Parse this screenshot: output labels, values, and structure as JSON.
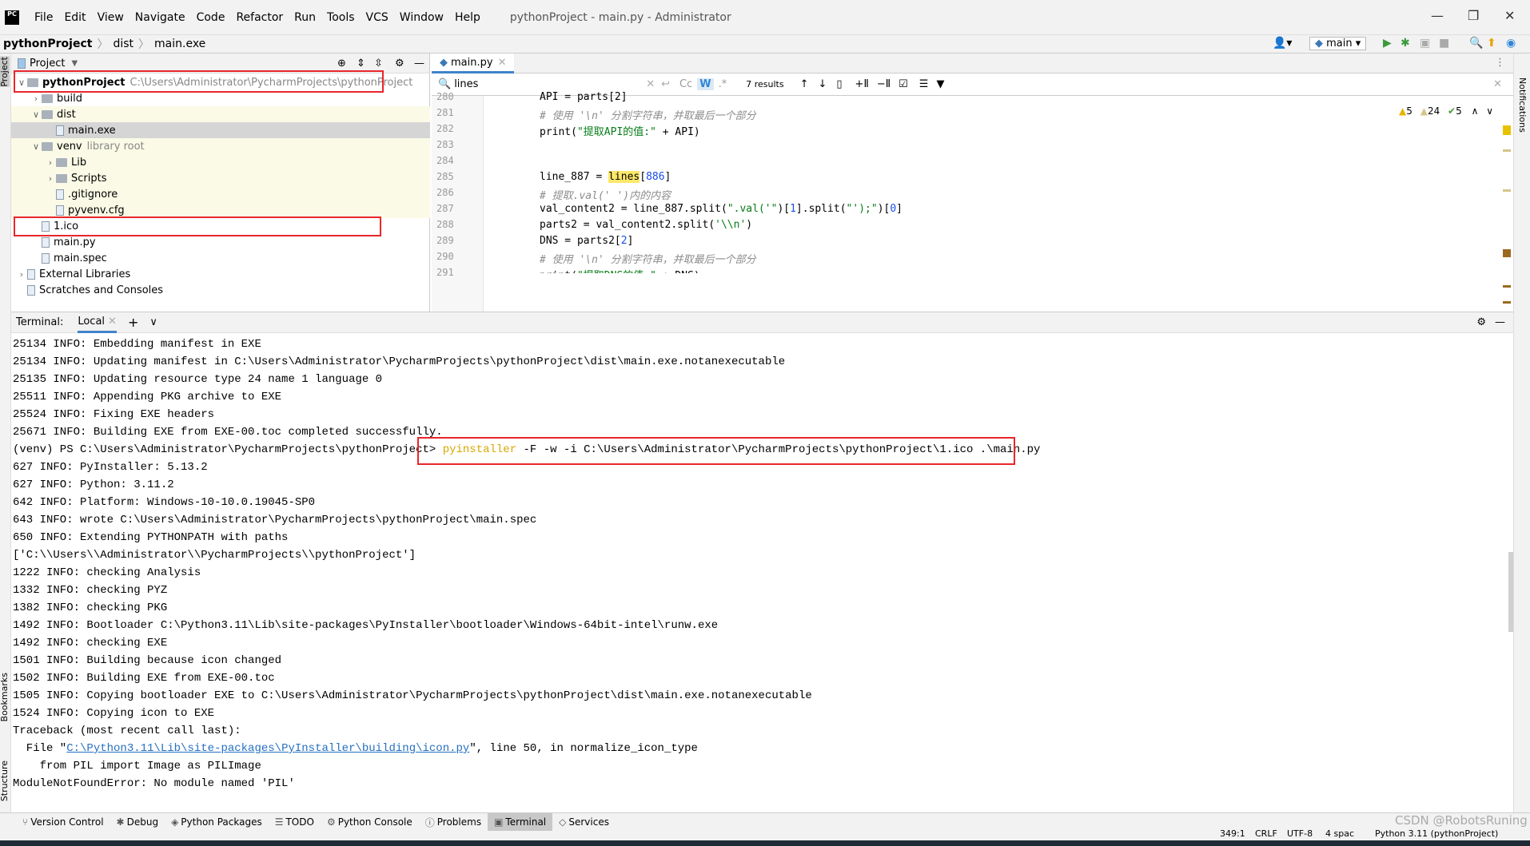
{
  "app": {
    "logo": "PC",
    "window_title": "pythonProject - main.py - Administrator"
  },
  "menu": [
    "File",
    "Edit",
    "View",
    "Navigate",
    "Code",
    "Refactor",
    "Run",
    "Tools",
    "VCS",
    "Window",
    "Help"
  ],
  "breadcrumb": [
    "pythonProject",
    "dist",
    "main.exe"
  ],
  "run_config": "main",
  "side_labels": {
    "project": "Project",
    "bookmarks": "Bookmarks",
    "structure": "Structure",
    "notifications": "Notifications"
  },
  "project_panel": {
    "title": "Project",
    "tree": [
      {
        "label": "pythonProject",
        "hint": "C:\\Users\\Administrator\\PycharmProjects\\pythonProject",
        "type": "folder",
        "depth": 0,
        "open": true,
        "bold": true
      },
      {
        "label": "build",
        "type": "folder",
        "depth": 1,
        "open": false
      },
      {
        "label": "dist",
        "type": "folder",
        "depth": 1,
        "open": true
      },
      {
        "label": "main.exe",
        "type": "file",
        "depth": 2,
        "selected": true
      },
      {
        "label": "venv",
        "hint": "library root",
        "type": "folder",
        "depth": 1,
        "open": true
      },
      {
        "label": "Lib",
        "type": "folder",
        "depth": 2,
        "open": false
      },
      {
        "label": "Scripts",
        "type": "folder",
        "depth": 2,
        "open": false
      },
      {
        "label": ".gitignore",
        "type": "file",
        "depth": 2
      },
      {
        "label": "pyvenv.cfg",
        "type": "file",
        "depth": 2
      },
      {
        "label": "1.ico",
        "type": "file",
        "depth": 1
      },
      {
        "label": "main.py",
        "type": "file",
        "depth": 1
      },
      {
        "label": "main.spec",
        "type": "file",
        "depth": 1
      },
      {
        "label": "External Libraries",
        "type": "lib",
        "depth": 0,
        "open": false
      },
      {
        "label": "Scratches and Consoles",
        "type": "scratch",
        "depth": 0
      }
    ]
  },
  "editor": {
    "tab": "main.py",
    "search": {
      "query": "lines",
      "results": "7 results",
      "cc": "Cc",
      "w": "W",
      "regex": ".*"
    },
    "inspections": {
      "warnings": "5",
      "weak_warnings": "24",
      "ok": "5"
    },
    "lines": [
      {
        "n": "280",
        "segs": [
          [
            "API = parts[2]",
            ""
          ]
        ]
      },
      {
        "n": "281",
        "segs": [
          [
            "# 使用 '\\n' 分割字符串，并取最后一个部分",
            "cm"
          ]
        ]
      },
      {
        "n": "282",
        "segs": [
          [
            "print(",
            ""
          ],
          [
            "\"提取API的值:\"",
            "str"
          ],
          [
            " + API)",
            ""
          ]
        ]
      },
      {
        "n": "283",
        "segs": []
      },
      {
        "n": "284",
        "segs": []
      },
      {
        "n": "285",
        "segs": [
          [
            "line_887 = ",
            ""
          ],
          [
            "lines",
            "hl"
          ],
          [
            "[",
            ""
          ],
          [
            "886",
            "num"
          ],
          [
            "]",
            ""
          ]
        ]
      },
      {
        "n": "286",
        "segs": [
          [
            "# 提取.val(' ')内的内容",
            "cm"
          ]
        ]
      },
      {
        "n": "287",
        "segs": [
          [
            "val_content2 = line_887.split(",
            ""
          ],
          [
            "\".val('\"",
            "str"
          ],
          [
            ")[",
            ""
          ],
          [
            "1",
            "num"
          ],
          [
            "].split(",
            ""
          ],
          [
            "\"');\"",
            "str"
          ],
          [
            ")[",
            ""
          ],
          [
            "0",
            "num"
          ],
          [
            "]",
            ""
          ]
        ]
      },
      {
        "n": "288",
        "segs": [
          [
            "parts2 = val_content2.split(",
            ""
          ],
          [
            "'\\\\n'",
            "str"
          ],
          [
            ")",
            ""
          ]
        ]
      },
      {
        "n": "289",
        "segs": [
          [
            "DNS = parts2[",
            ""
          ],
          [
            "2",
            "num"
          ],
          [
            "]",
            ""
          ]
        ]
      },
      {
        "n": "290",
        "segs": [
          [
            "# 使用 '\\n' 分割字符串，并取最后一个部分",
            "cm"
          ]
        ]
      },
      {
        "n": "291",
        "segs": [
          [
            "print(",
            ""
          ],
          [
            "\"提取DNS的值:\"",
            "str"
          ],
          [
            " + DNS)",
            ""
          ]
        ]
      }
    ]
  },
  "terminal": {
    "label": "Terminal:",
    "tab": "Local",
    "lines": [
      {
        "t": "25134 INFO: Embedding manifest in EXE"
      },
      {
        "t": "25134 INFO: Updating manifest in C:\\Users\\Administrator\\PycharmProjects\\pythonProject\\dist\\main.exe.notanexecutable"
      },
      {
        "t": "25135 INFO: Updating resource type 24 name 1 language 0"
      },
      {
        "t": "25511 INFO: Appending PKG archive to EXE"
      },
      {
        "t": "25524 INFO: Fixing EXE headers"
      },
      {
        "t": "25671 INFO: Building EXE from EXE-00.toc completed successfully."
      },
      {
        "prompt": "(venv) PS C:\\Users\\Administrator\\PycharmProjects\\pythonProject> ",
        "cmd": "pyinstaller",
        "args": " -F -w -i C:\\Users\\Administrator\\PycharmProjects\\pythonProject\\1.ico .\\main.py"
      },
      {
        "t": "627 INFO: PyInstaller: 5.13.2"
      },
      {
        "t": "627 INFO: Python: 3.11.2"
      },
      {
        "t": "642 INFO: Platform: Windows-10-10.0.19045-SP0"
      },
      {
        "t": "643 INFO: wrote C:\\Users\\Administrator\\PycharmProjects\\pythonProject\\main.spec"
      },
      {
        "t": "650 INFO: Extending PYTHONPATH with paths"
      },
      {
        "t": "['C:\\\\Users\\\\Administrator\\\\PycharmProjects\\\\pythonProject']"
      },
      {
        "t": "1222 INFO: checking Analysis"
      },
      {
        "t": "1332 INFO: checking PYZ"
      },
      {
        "t": "1382 INFO: checking PKG"
      },
      {
        "t": "1492 INFO: Bootloader C:\\Python3.11\\Lib\\site-packages\\PyInstaller\\bootloader\\Windows-64bit-intel\\runw.exe"
      },
      {
        "t": "1492 INFO: checking EXE"
      },
      {
        "t": "1501 INFO: Building because icon changed"
      },
      {
        "t": "1502 INFO: Building EXE from EXE-00.toc"
      },
      {
        "t": "1505 INFO: Copying bootloader EXE to C:\\Users\\Administrator\\PycharmProjects\\pythonProject\\dist\\main.exe.notanexecutable"
      },
      {
        "t": "1524 INFO: Copying icon to EXE"
      },
      {
        "t": "Traceback (most recent call last):"
      },
      {
        "pre": "  File \"",
        "link": "C:\\Python3.11\\Lib\\site-packages\\PyInstaller\\building\\icon.py",
        "post": "\", line 50, in normalize_icon_type"
      },
      {
        "t": "    from PIL import Image as PILImage"
      },
      {
        "t": "ModuleNotFoundError: No module named 'PIL'"
      }
    ]
  },
  "tool_windows": [
    "Version Control",
    "Debug",
    "Python Packages",
    "TODO",
    "Python Console",
    "Problems",
    "Terminal",
    "Services"
  ],
  "active_tool_window": "Terminal",
  "status": {
    "position": "349:1",
    "line_sep": "CRLF",
    "encoding": "UTF-8",
    "indent": "4 spac",
    "interpreter": "Python 3.11 (pythonProject)",
    "watermark": "CSDN @RobotsRuning"
  },
  "colors": {
    "highlight": "#e8262b",
    "search_match": "#fce86a",
    "accent": "#4083c9"
  }
}
